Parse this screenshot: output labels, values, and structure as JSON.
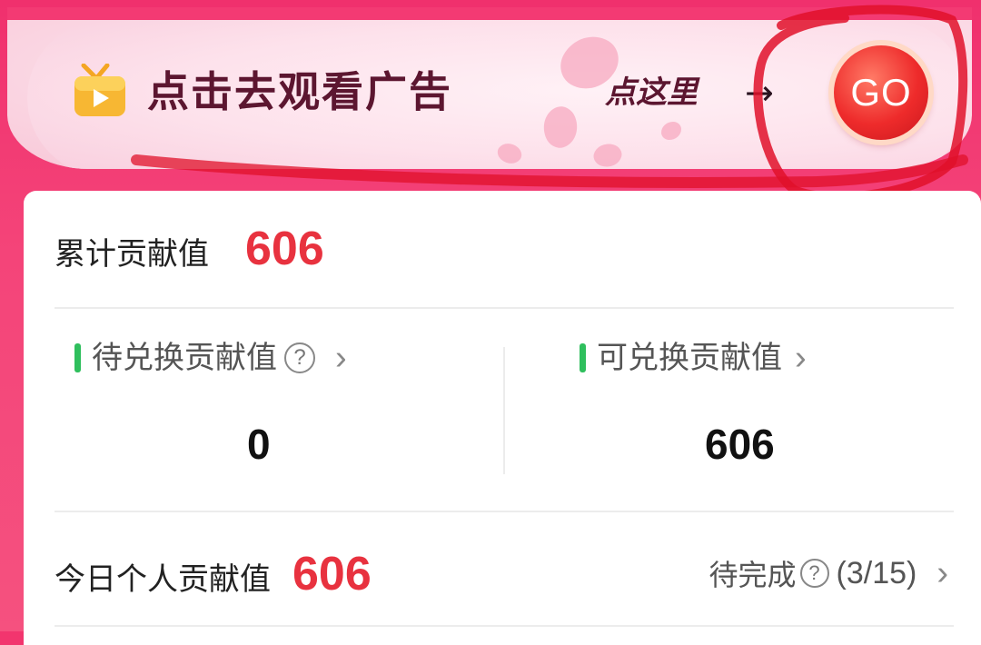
{
  "ad_banner": {
    "title": "点击去观看广告",
    "cta_text": "点这里",
    "arrow": "→",
    "go_label": "GO"
  },
  "contribution": {
    "total": {
      "label": "累计贡献值",
      "value": "606"
    },
    "pending": {
      "label": "待兑换贡献值",
      "help": "?",
      "chevron": "›",
      "value": "0"
    },
    "redeemable": {
      "label": "可兑换贡献值",
      "chevron": "›",
      "value": "606"
    },
    "today": {
      "label": "今日个人贡献值",
      "value": "606",
      "status": "待完成",
      "help": "?",
      "progress": "(3/15)",
      "chevron": "›"
    }
  },
  "colors": {
    "brand_pink": "#f0306d",
    "value_red": "#e8323f",
    "indicator_green": "#2fbf5d",
    "title_maroon": "#5c1630"
  },
  "icons": [
    "tv-gift-icon",
    "question-circle-icon",
    "chevron-right-icon",
    "go-button-icon"
  ]
}
